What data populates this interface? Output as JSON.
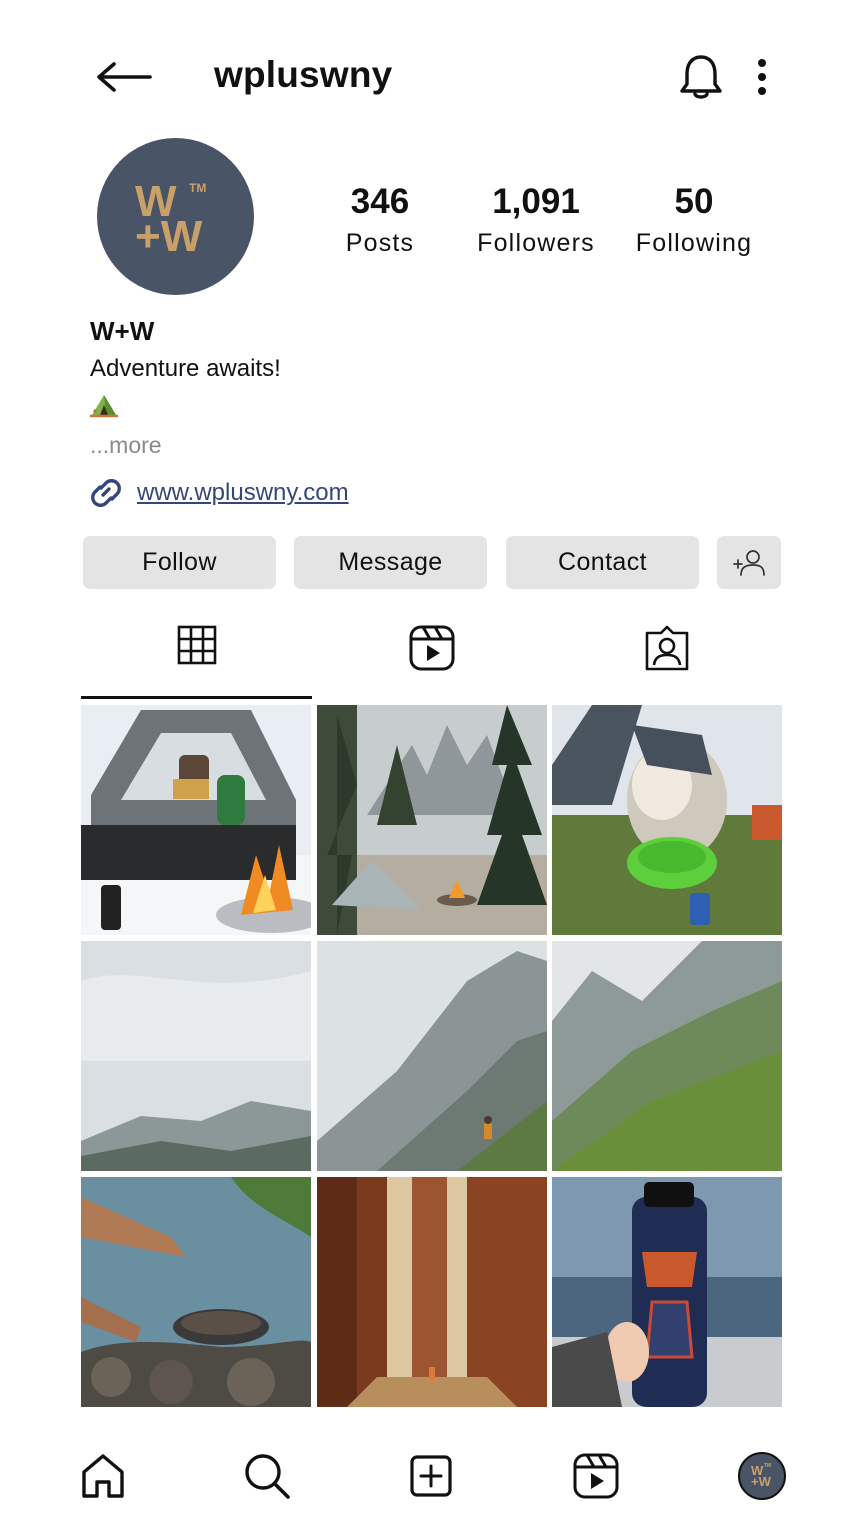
{
  "header": {
    "username": "wpluswny",
    "icons": {
      "back": "arrow-left-icon",
      "notifications": "bell-icon",
      "more": "vertical-dots-icon"
    }
  },
  "profile": {
    "avatar_logo": "W+W",
    "avatar_color": "#4a5467",
    "logo_color": "#c9a06a",
    "display_name": "W+W",
    "bio": "Adventure awaits!",
    "bio_emoji": "camping-tent-emoji",
    "more_label": "...more",
    "website": "www.wpluswny.com",
    "link_color": "#35477a"
  },
  "stats": {
    "posts": {
      "value": "346",
      "label": "Posts"
    },
    "followers": {
      "value": "1,091",
      "label": "Followers"
    },
    "following": {
      "value": "50",
      "label": "Following"
    }
  },
  "actions": {
    "follow": "Follow",
    "message": "Message",
    "contact": "Contact",
    "suggest_icon": "add-user-icon"
  },
  "tabs": [
    {
      "name": "posts-grid",
      "icon": "grid-icon",
      "active": true
    },
    {
      "name": "reels",
      "icon": "reels-icon",
      "active": false
    },
    {
      "name": "tagged",
      "icon": "tagged-person-icon",
      "active": false
    }
  ],
  "posts": [
    {
      "subject": "man reading in truck tent by campfire with lantern"
    },
    {
      "subject": "tent by campfire in pine forest below mountain peaks"
    },
    {
      "subject": "dog drinking from green collapsible bowl near tent"
    },
    {
      "subject": "misty mountain ridge (panorama part 1)"
    },
    {
      "subject": "hiker on mountain ridge in mist (panorama part 2)"
    },
    {
      "subject": "grassy mountain slope (panorama part 3)"
    },
    {
      "subject": "cooking with pan over rocks by lake"
    },
    {
      "subject": "hiker among giant redwood trees"
    },
    {
      "subject": "navy water bottle with stickers by lake"
    }
  ],
  "bottom_nav": [
    {
      "name": "home",
      "icon": "home-icon"
    },
    {
      "name": "search",
      "icon": "search-icon"
    },
    {
      "name": "create",
      "icon": "plus-square-icon"
    },
    {
      "name": "reels",
      "icon": "reels-icon"
    },
    {
      "name": "profile",
      "icon": "profile-avatar-icon"
    }
  ]
}
